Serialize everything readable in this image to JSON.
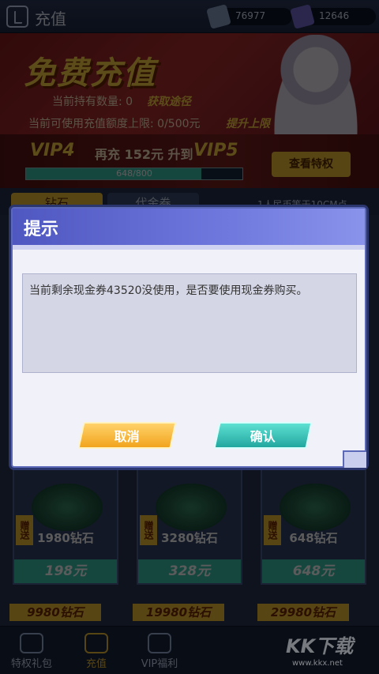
{
  "header": {
    "title": "充值",
    "currency": [
      {
        "icon": "cash-voucher-icon",
        "value": "76977"
      },
      {
        "icon": "diamond-icon",
        "value": "12646"
      }
    ]
  },
  "banner": {
    "title": "免费充值",
    "holding_label": "当前持有数量: 0",
    "get_link": "获取途径",
    "limit_label": "当前可使用充值额度上限: 0/500元",
    "raise_link": "提升上限"
  },
  "vip": {
    "current": "VIP4",
    "middle": "再充 152元 升到",
    "next": "VIP5",
    "progress_text": "648/800",
    "progress_fraction": 0.81,
    "view_button": "查看特权"
  },
  "tabs": [
    {
      "label": "钻石"
    },
    {
      "label": "代金券"
    }
  ],
  "tip": "1人民币等于10CM点",
  "cards": [
    {
      "badge": "赠送",
      "amount": "1980钻石",
      "price": "198元"
    },
    {
      "badge": "赠送",
      "amount": "3280钻石",
      "price": "328元"
    },
    {
      "badge": "赠送",
      "amount": "648钻石",
      "price": "648元"
    }
  ],
  "chips": [
    "9980钻石",
    "19980钻石",
    "29980钻石"
  ],
  "nav": [
    {
      "label": "特权礼包"
    },
    {
      "label": "充值"
    },
    {
      "label": "VIP福利"
    }
  ],
  "dialog": {
    "title": "提示",
    "message": "当前剩余现金券43520没使用，是否要使用现金券购买。",
    "cancel": "取消",
    "confirm": "确认"
  },
  "watermark": {
    "text": "KK下载",
    "sub": "www.kkx.net"
  },
  "colors": {
    "accent": "#f3c23a",
    "teal": "#3fc7b2",
    "dialog_header": "#5c68b8"
  }
}
